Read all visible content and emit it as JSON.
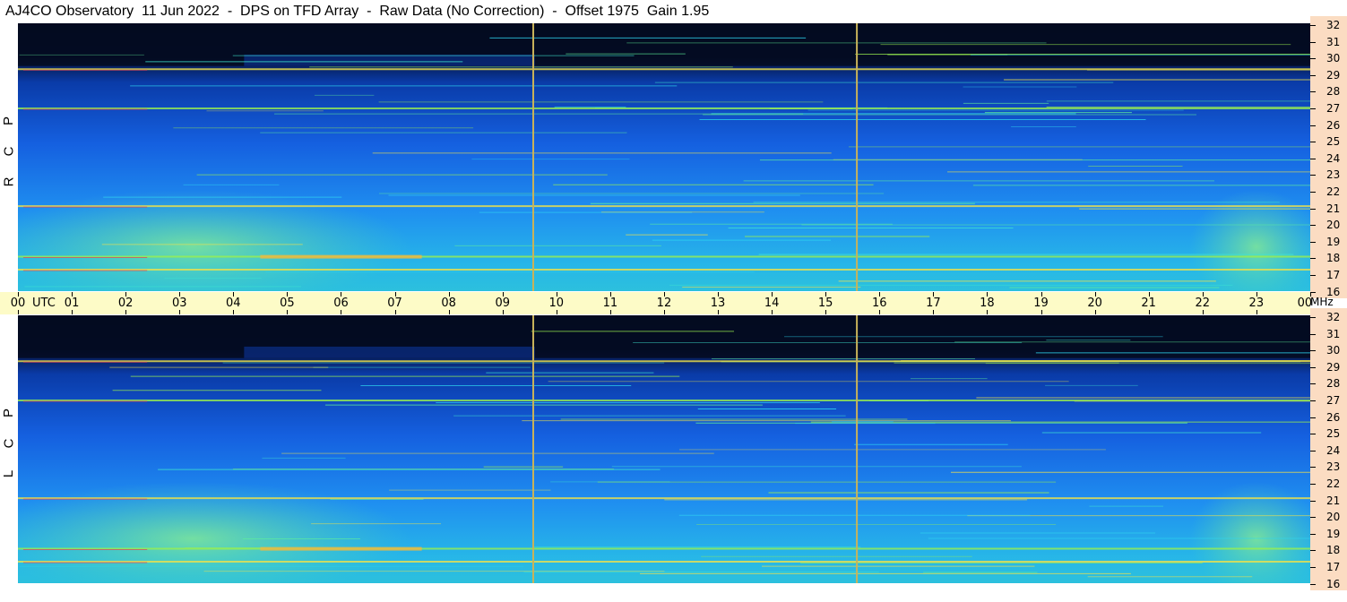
{
  "title": "AJ4CO Observatory  11 Jun 2022  -  DPS on TFD Array  -  Raw Data (No Correction)  -  Offset 1975  Gain 1.95",
  "panels": [
    {
      "name": "RCP",
      "letters": [
        "R",
        "C",
        "P"
      ]
    },
    {
      "name": "LCP",
      "letters": [
        "L",
        "C",
        "P"
      ]
    }
  ],
  "time_axis": {
    "unit_label": "UTC",
    "tick_labels": [
      "00",
      "01",
      "02",
      "03",
      "04",
      "05",
      "06",
      "07",
      "08",
      "09",
      "10",
      "11",
      "12",
      "13",
      "14",
      "15",
      "16",
      "17",
      "18",
      "19",
      "20",
      "21",
      "22",
      "23",
      "00"
    ]
  },
  "freq_axis": {
    "unit_label": "MHz",
    "tick_labels": [
      "32",
      "31",
      "30",
      "29",
      "28",
      "27",
      "26",
      "25",
      "24",
      "23",
      "22",
      "21",
      "20",
      "19",
      "18",
      "17",
      "16"
    ]
  },
  "colors": {
    "background": "#06112e",
    "marker_line": "#c8b25a",
    "time_axis_bg": "#fdfbc7",
    "freq_axis_bg": "#fbdcc2"
  },
  "chart_data": {
    "type": "heatmap",
    "title": "AJ4CO Observatory  11 Jun 2022  -  DPS on TFD Array  -  Raw Data (No Correction)  -  Offset 1975  Gain 1.95",
    "xlabel": "UTC",
    "ylabel": "MHz",
    "x_range_hours": [
      0,
      24
    ],
    "y_range_mhz": [
      16,
      32
    ],
    "markers_utc_hours": [
      9.57,
      15.58
    ],
    "panels": [
      "RCP",
      "LCP"
    ],
    "strong_emission_bands_mhz": [
      17.1,
      17.9,
      21.0,
      27.0,
      29.4
    ]
  }
}
